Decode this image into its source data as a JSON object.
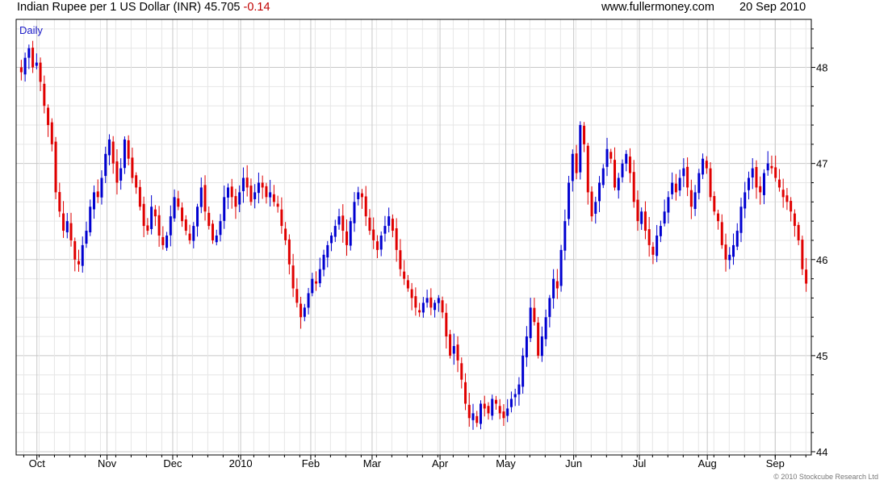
{
  "header": {
    "title": "Indian Rupee per 1 US Dollar (INR)",
    "last": "45.705",
    "change": "-0.14",
    "website": "www.fullermoney.com",
    "date": "20 Sep 2010"
  },
  "colors": {
    "up": "#0000d0",
    "down": "#e00000",
    "grid": "#d8d8d8",
    "frame": "#000000",
    "label": "#1a1ac8"
  },
  "footer": {
    "copyright": "© 2010 Stockcube Research Ltd"
  },
  "chart_data": {
    "type": "candlestick",
    "period_label": "Daily",
    "ylim": [
      44,
      48.5
    ],
    "y_ticks": [
      44,
      45,
      46,
      47,
      48
    ],
    "y_tick_labels": [
      "44",
      "45",
      "46",
      "47",
      "48"
    ],
    "x_months": [
      {
        "label": "Oct",
        "day": 8
      },
      {
        "label": "Nov",
        "day": 40
      },
      {
        "label": "Dec",
        "day": 70
      },
      {
        "label": "2010",
        "day": 101
      },
      {
        "label": "Feb",
        "day": 133
      },
      {
        "label": "Mar",
        "day": 161
      },
      {
        "label": "Apr",
        "day": 192
      },
      {
        "label": "May",
        "day": 222
      },
      {
        "label": "Jun",
        "day": 253
      },
      {
        "label": "Jul",
        "day": 283
      },
      {
        "label": "Aug",
        "day": 314
      },
      {
        "label": "Sep",
        "day": 345
      }
    ],
    "x_range_days": [
      0,
      360
    ],
    "closes": [
      47.95,
      48.1,
      48.2,
      48.0,
      48.05,
      47.85,
      47.6,
      47.4,
      47.2,
      46.7,
      46.5,
      46.3,
      46.4,
      46.2,
      46.0,
      45.95,
      46.15,
      46.3,
      46.55,
      46.7,
      46.65,
      46.85,
      47.1,
      47.25,
      47.0,
      46.8,
      46.95,
      47.25,
      47.05,
      46.85,
      46.75,
      46.55,
      46.35,
      46.3,
      46.55,
      46.45,
      46.25,
      46.15,
      46.25,
      46.45,
      46.65,
      46.55,
      46.4,
      46.3,
      46.2,
      46.35,
      46.55,
      46.75,
      46.5,
      46.35,
      46.2,
      46.25,
      46.4,
      46.65,
      46.75,
      46.65,
      46.55,
      46.7,
      46.85,
      46.75,
      46.6,
      46.7,
      46.8,
      46.75,
      46.65,
      46.7,
      46.6,
      46.55,
      46.35,
      46.2,
      45.95,
      45.7,
      45.55,
      45.4,
      45.5,
      45.65,
      45.8,
      45.75,
      45.9,
      46.05,
      46.15,
      46.25,
      46.35,
      46.45,
      46.3,
      46.15,
      46.4,
      46.6,
      46.7,
      46.65,
      46.45,
      46.3,
      46.2,
      46.1,
      46.25,
      46.35,
      46.45,
      46.3,
      46.1,
      45.9,
      45.8,
      45.7,
      45.6,
      45.5,
      45.45,
      45.55,
      45.6,
      45.5,
      45.55,
      45.6,
      45.45,
      45.2,
      45.0,
      45.1,
      44.95,
      44.75,
      44.5,
      44.35,
      44.4,
      44.3,
      44.5,
      44.45,
      44.4,
      44.55,
      44.5,
      44.4,
      44.35,
      44.45,
      44.55,
      44.6,
      44.7,
      45.0,
      45.2,
      45.5,
      45.35,
      45.0,
      45.2,
      45.4,
      45.6,
      45.8,
      45.7,
      46.1,
      46.4,
      46.8,
      47.1,
      46.9,
      47.4,
      47.2,
      46.7,
      46.45,
      46.6,
      46.8,
      46.95,
      47.15,
      47.05,
      46.75,
      46.85,
      47.0,
      47.1,
      46.9,
      46.6,
      46.4,
      46.5,
      46.3,
      46.15,
      46.05,
      46.25,
      46.35,
      46.5,
      46.65,
      46.8,
      46.7,
      46.85,
      46.95,
      46.75,
      46.55,
      46.7,
      46.9,
      47.05,
      46.95,
      46.65,
      46.5,
      46.4,
      46.15,
      46.0,
      46.05,
      46.15,
      46.3,
      46.55,
      46.7,
      46.85,
      46.95,
      46.75,
      46.7,
      46.9,
      47.0,
      46.95,
      46.85,
      46.75,
      46.65,
      46.6,
      46.5,
      46.35,
      46.2,
      45.9,
      45.75
    ]
  }
}
